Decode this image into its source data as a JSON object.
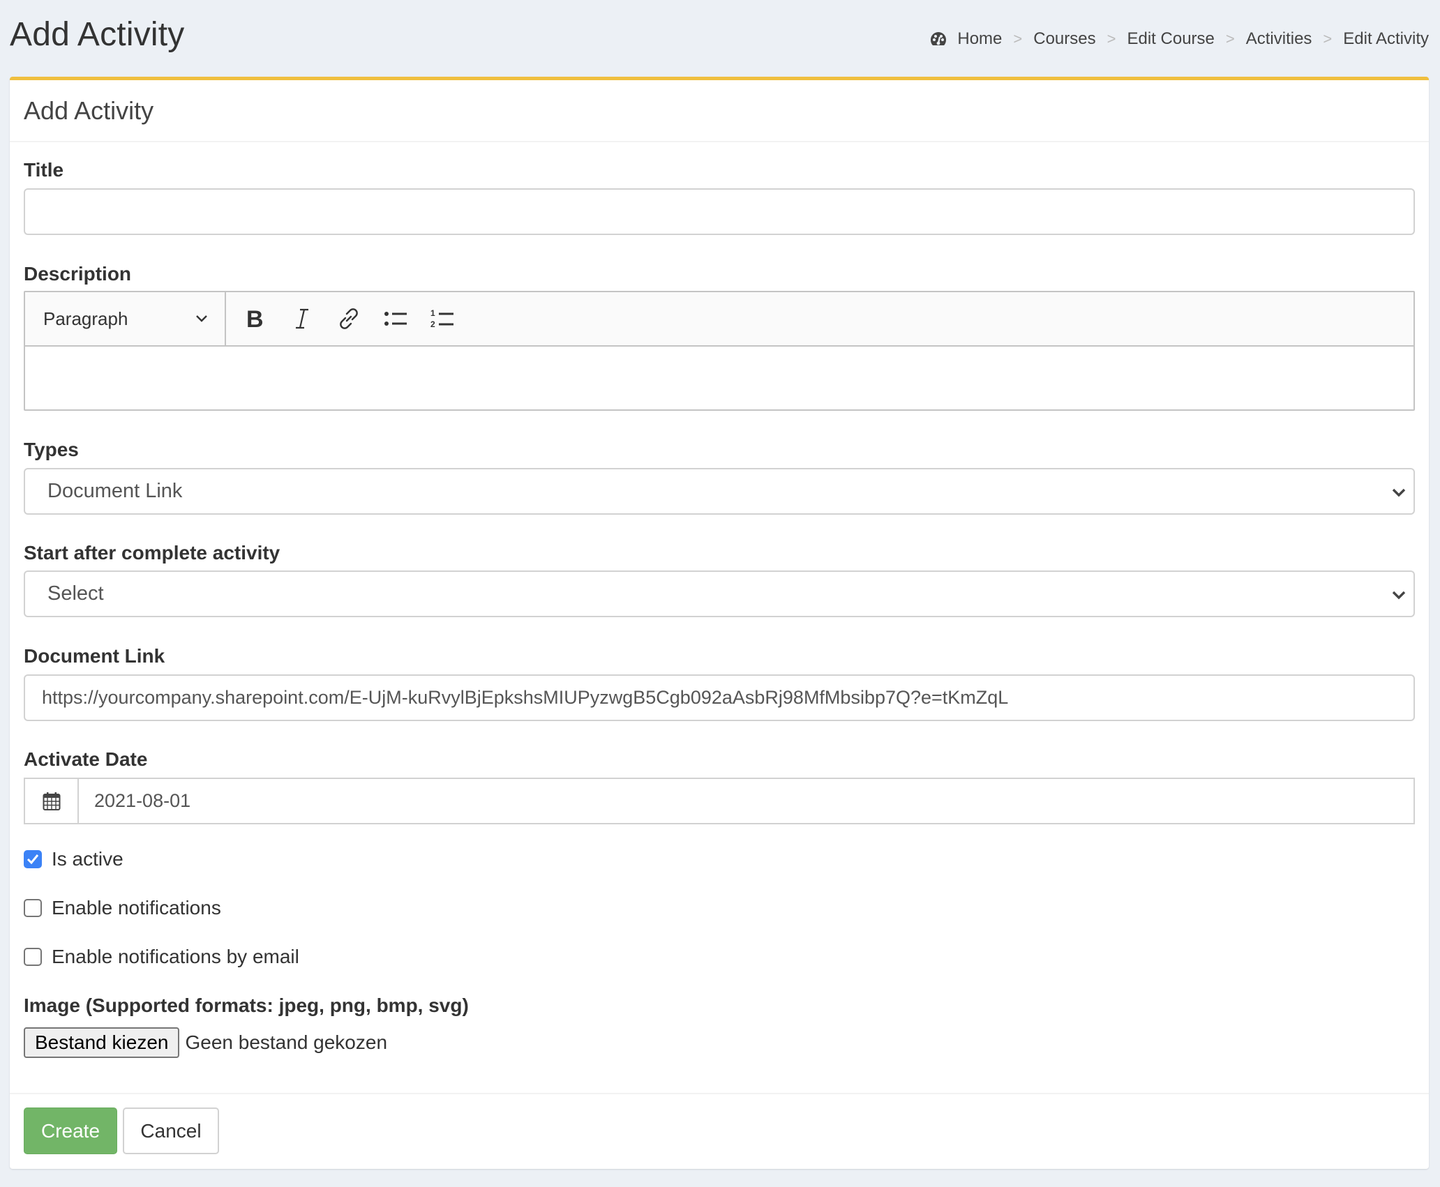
{
  "page": {
    "title": "Add Activity"
  },
  "breadcrumb": {
    "items": [
      {
        "label": "Home",
        "icon": "dashboard-icon"
      },
      {
        "label": "Courses"
      },
      {
        "label": "Edit Course"
      },
      {
        "label": "Activities"
      },
      {
        "label": "Edit Activity"
      }
    ],
    "separator": ">"
  },
  "card": {
    "title": "Add Activity",
    "accent_color": "#f0bf3e"
  },
  "form": {
    "title": {
      "label": "Title",
      "value": ""
    },
    "description": {
      "label": "Description",
      "heading_select": "Paragraph",
      "toolbar": [
        "bold-icon",
        "italic-icon",
        "link-icon",
        "bulleted-list-icon",
        "numbered-list-icon"
      ],
      "value": ""
    },
    "types": {
      "label": "Types",
      "selected": "Document Link"
    },
    "start_after": {
      "label": "Start after complete activity",
      "selected": "Select"
    },
    "document_link": {
      "label": "Document Link",
      "value": "https://yourcompany.sharepoint.com/E-UjM-kuRvylBjEpkshsMIUPyzwgB5Cgb092aAsbRj98MfMbsibp7Q?e=tKmZqL"
    },
    "activate_date": {
      "label": "Activate Date",
      "value": "2021-08-01",
      "icon": "calendar-icon"
    },
    "checkboxes": [
      {
        "label": "Is active",
        "checked": true
      },
      {
        "label": "Enable notifications",
        "checked": false
      },
      {
        "label": "Enable notifications by email",
        "checked": false
      }
    ],
    "image": {
      "label": "Image (Supported formats: jpeg, png, bmp, svg)",
      "button_label": "Bestand kiezen",
      "status": "Geen bestand gekozen"
    }
  },
  "actions": {
    "create_label": "Create",
    "cancel_label": "Cancel",
    "create_color": "#72b567"
  }
}
